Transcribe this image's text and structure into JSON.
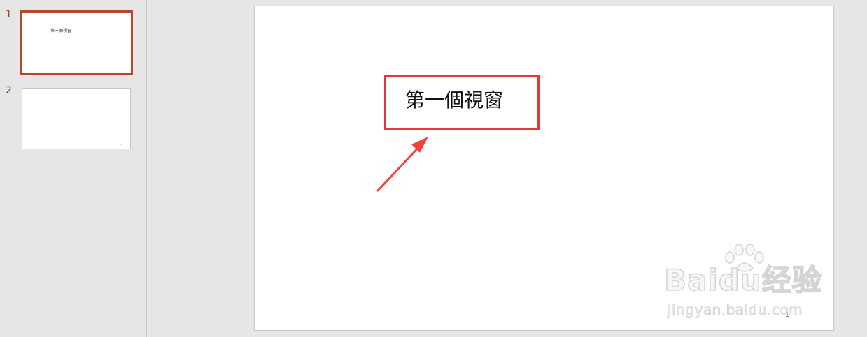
{
  "thumbnails": [
    {
      "number": "1",
      "title": "第一個視窗",
      "selected": true
    },
    {
      "number": "2",
      "title": "",
      "page_number": "2",
      "selected": false
    }
  ],
  "slide": {
    "title": "第一個視窗",
    "page_number": "1"
  },
  "watermark": {
    "brand": "Baidu经验",
    "url": "jingyan.baidu.com"
  },
  "annotation": {
    "highlight_color": "#e53935",
    "arrow_color": "#f44336"
  },
  "colors": {
    "selected_thumb_border": "#b7472a",
    "selected_thumb_number": "#c0392b"
  }
}
